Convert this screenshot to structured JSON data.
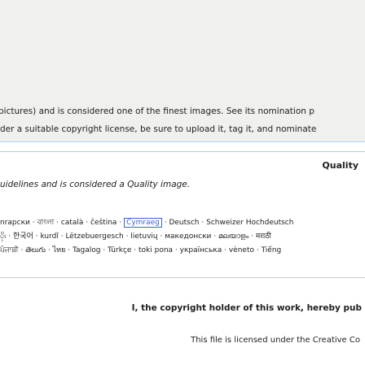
{
  "featured": {
    "line1": "pictures) and is considered one of the finest images. See its nomination p",
    "line2": "der a suitable copyright license, be sure to upload it, tag it, and nominate"
  },
  "quality": {
    "title": "Quality",
    "description": "uidelines and is considered a Quality image.",
    "languages_row1": [
      "nrapcки",
      "বাংলা",
      "català",
      "čeština",
      "Cymraeg",
      "Deutsch",
      "Schweizer Hochdeutsch"
    ],
    "languages_row2": [
      "ပိုး",
      "한국어",
      "kurdî",
      "Lëtzebuergesch",
      "lietuvių",
      "македонски",
      "മലയാളം",
      "मराठी"
    ],
    "languages_row3": [
      "ਪੰਜਾਬੀ",
      "తెలుగు",
      "ไทย",
      "Tagalog",
      "Türkçe",
      "toki pona",
      "українська",
      "vèneto",
      "Tiếng"
    ],
    "current_language": "Cymraeg",
    "separator": " · "
  },
  "license": {
    "line1": "I, the copyright holder of this work, hereby pub",
    "line2": "This file is licensed under the Creative Co"
  }
}
